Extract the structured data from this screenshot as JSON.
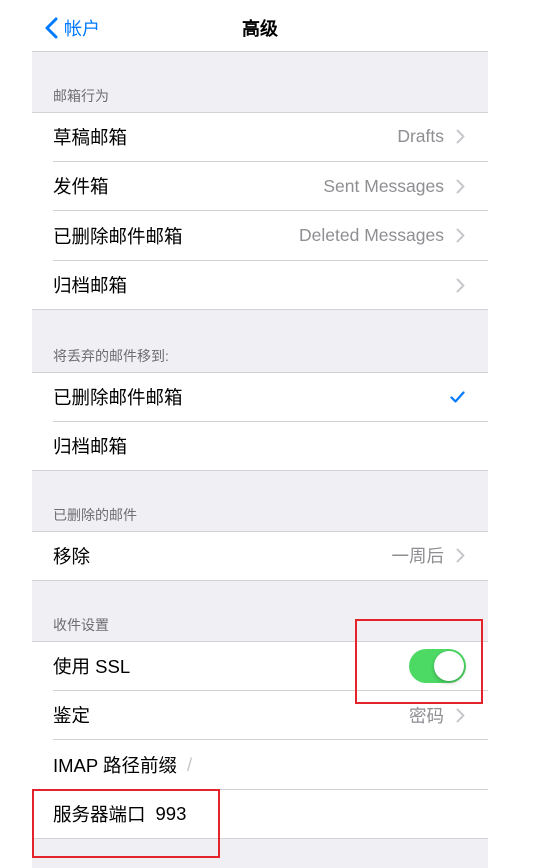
{
  "nav": {
    "back_label": "帐户",
    "back_icon": "chevron-left-icon",
    "title": "高级"
  },
  "colors": {
    "accent": "#007aff",
    "toggle_on": "#4cd964",
    "grouped_background": "#efeff4",
    "label_text": "#000000",
    "secondary_text": "#8e8e93",
    "placeholder_text": "#c7c7cc",
    "header_text": "#6d6d72",
    "separator": "#d1d1d6",
    "disclosure": "#c7c7cc",
    "annotation": "#e3242b"
  },
  "sections": [
    {
      "header": "邮箱行为",
      "rows": [
        {
          "label": "草稿邮箱",
          "value": "Drafts",
          "accessory": "chevron-right-icon"
        },
        {
          "label": "发件箱",
          "value": "Sent Messages",
          "accessory": "chevron-right-icon"
        },
        {
          "label": "已删除邮件邮箱",
          "value": "Deleted Messages",
          "accessory": "chevron-right-icon"
        },
        {
          "label": "归档邮箱",
          "accessory": "chevron-right-icon"
        }
      ]
    },
    {
      "header": "将丢弃的邮件移到:",
      "rows": [
        {
          "label": "已删除邮件邮箱",
          "checked": true,
          "accessory": "checkmark-icon"
        },
        {
          "label": "归档邮箱",
          "checked": false,
          "accessory": "checkmark-icon"
        }
      ]
    },
    {
      "header": "已删除的邮件",
      "rows": [
        {
          "label": "移除",
          "value": "一周后",
          "accessory": "chevron-right-icon"
        }
      ]
    },
    {
      "header": "收件设置",
      "rows": [
        {
          "label": "使用 SSL",
          "toggle_on": true
        },
        {
          "label": "鉴定",
          "value": "密码",
          "accessory": "chevron-right-icon"
        },
        {
          "label": "IMAP 路径前缀",
          "placeholder": "/"
        },
        {
          "label": "服务器端口",
          "value": "993"
        }
      ]
    }
  ]
}
